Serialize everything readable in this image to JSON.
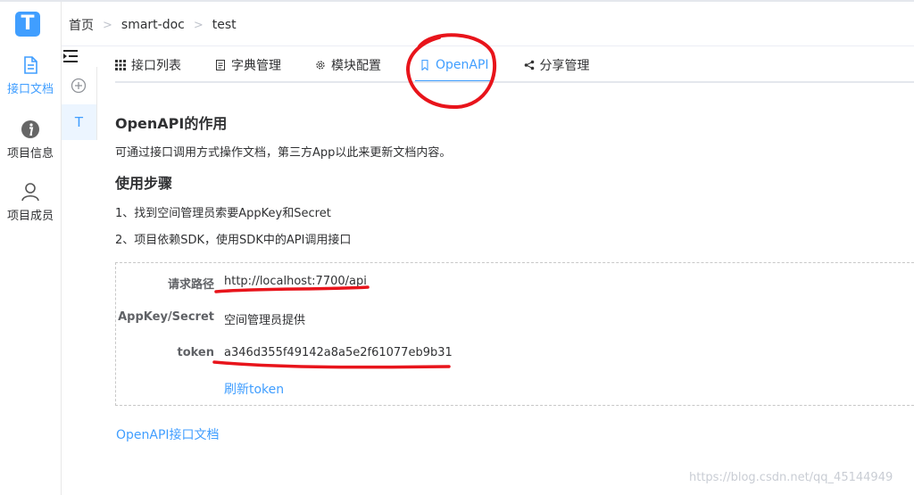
{
  "app": {
    "logo_letter": "T",
    "accent_color": "#409eff"
  },
  "sidebar": {
    "items": [
      {
        "label": "接口文档",
        "icon": "document-icon",
        "active": true
      },
      {
        "label": "项目信息",
        "icon": "info-icon",
        "active": false
      },
      {
        "label": "项目成员",
        "icon": "user-icon",
        "active": false
      }
    ]
  },
  "breadcrumb": {
    "items": [
      "首页",
      "smart-doc",
      "test"
    ]
  },
  "tree": {
    "item_label": "T"
  },
  "tabs": [
    {
      "label": "接口列表",
      "icon": "grid-icon",
      "active": false
    },
    {
      "label": "字典管理",
      "icon": "file-icon",
      "active": false
    },
    {
      "label": "模块配置",
      "icon": "gear-icon",
      "active": false
    },
    {
      "label": "OpenAPI",
      "icon": "bookmark-icon",
      "active": true
    },
    {
      "label": "分享管理",
      "icon": "share-icon",
      "active": false
    }
  ],
  "content": {
    "title": "OpenAPI的作用",
    "description": "可通过接口调用方式操作文档，第三方App以此来更新文档内容。",
    "steps_title": "使用步骤",
    "steps": [
      "1、找到空间管理员索要AppKey和Secret",
      "2、项目依赖SDK，使用SDK中的API调用接口"
    ],
    "info": {
      "request_path_label": "请求路径",
      "request_path_value": "http://localhost:7700/api",
      "appkey_label": "AppKey/Secret",
      "appkey_value": "空间管理员提供",
      "token_label": "token",
      "token_value": "a346d355f49142a8a5e2f61077eb9b31",
      "refresh_label": "刷新token"
    },
    "api_doc_link": "OpenAPI接口文档"
  },
  "watermark": "https://blog.csdn.net/qq_45144949",
  "annotation_color": "#e8141b"
}
